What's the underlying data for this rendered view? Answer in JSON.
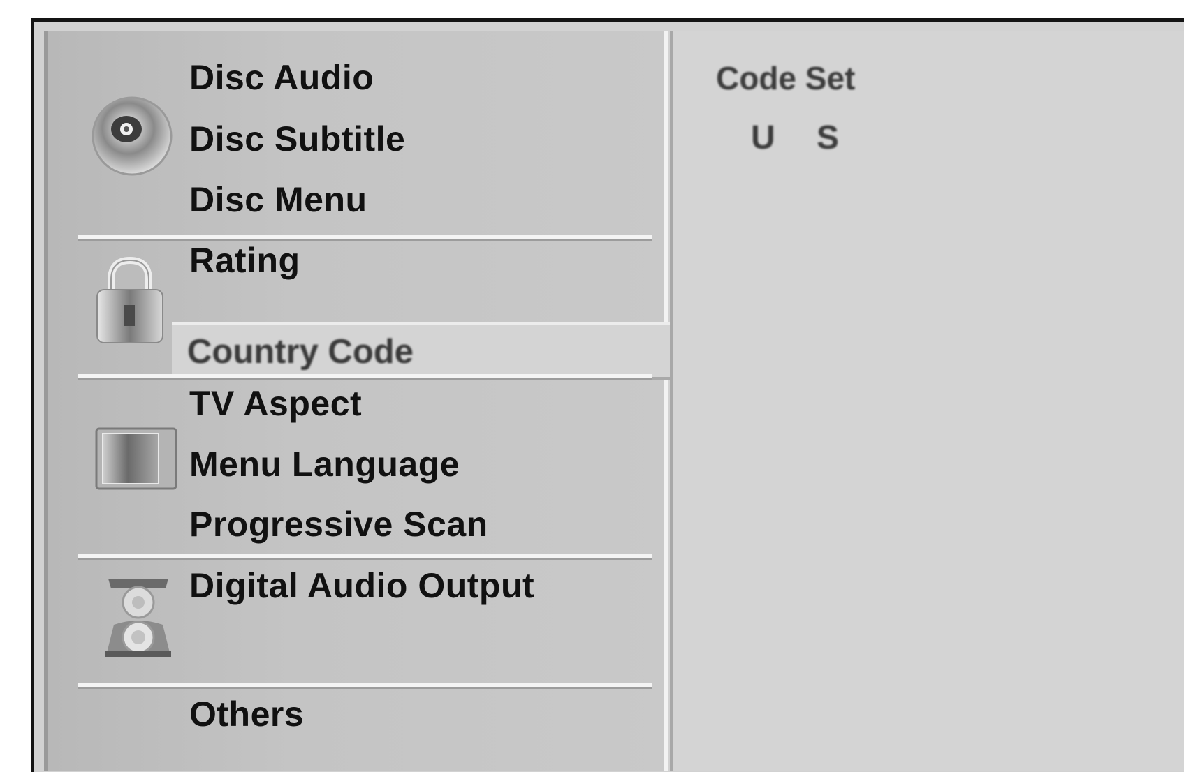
{
  "menu": {
    "items": [
      {
        "label": "Disc Audio"
      },
      {
        "label": "Disc Subtitle"
      },
      {
        "label": "Disc Menu"
      },
      {
        "label": "Rating"
      },
      {
        "label": "Country Code"
      },
      {
        "label": "TV Aspect"
      },
      {
        "label": "Menu Language"
      },
      {
        "label": "Progressive Scan"
      },
      {
        "label": "Digital Audio Output"
      },
      {
        "label": "Others"
      }
    ],
    "selected_index": 4
  },
  "icons": {
    "disc": "disc-icon",
    "lock": "lock-icon",
    "tv": "tv-icon",
    "speaker": "speaker-icon"
  },
  "panel": {
    "title": "Code Set",
    "code_chars": [
      "U",
      "S"
    ]
  }
}
